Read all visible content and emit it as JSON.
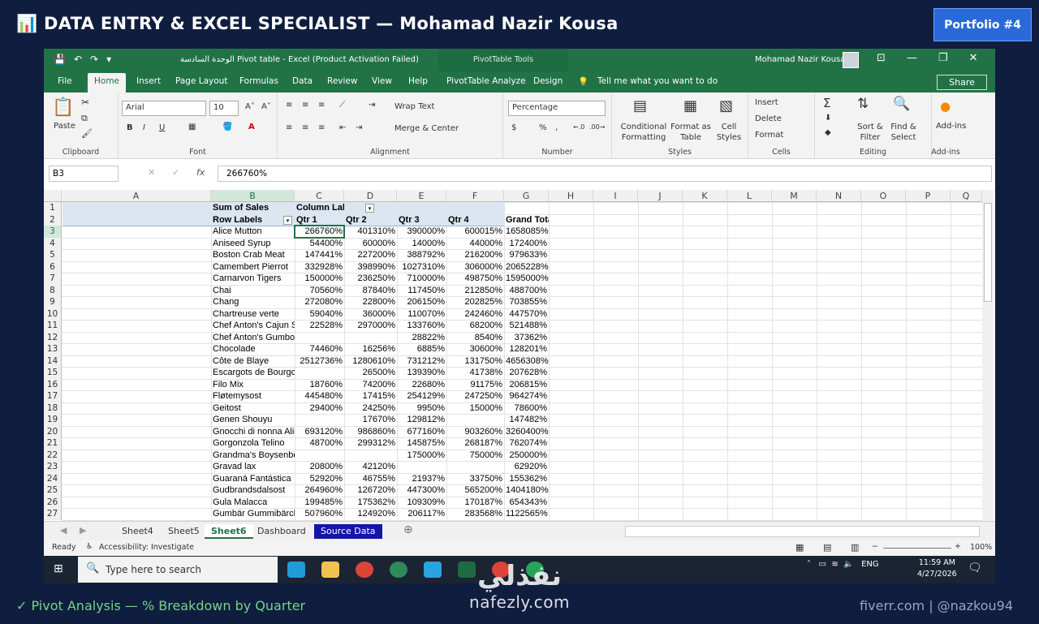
{
  "banner": {
    "title": "📊 DATA ENTRY & EXCEL SPECIALIST — Mohamad Nazir Kousa",
    "badge": "Portfolio #4"
  },
  "footer": {
    "left": "✓ Pivot Analysis — % Breakdown by Quarter",
    "right": "fiverr.com | @nazkou94"
  },
  "watermark": {
    "arabic": "نفذلي",
    "latin": "nafezly.com"
  },
  "titlebar": {
    "doc_title": "الوحدة السادسة Pivot table  -  Excel (Product Activation Failed)",
    "context_tools": "PivotTable Tools",
    "user": "Mohamad Nazir Kousa"
  },
  "tabs": [
    "File",
    "Home",
    "Insert",
    "Page Layout",
    "Formulas",
    "Data",
    "Review",
    "View",
    "Help",
    "PivotTable Analyze",
    "Design"
  ],
  "tell_me": "Tell me what you want to do",
  "share": "Share",
  "ribbon": {
    "clipboard": {
      "label": "Clipboard",
      "paste": "Paste"
    },
    "font": {
      "label": "Font",
      "name": "Arial",
      "size": "10",
      "bold": "B",
      "italic": "I",
      "underline": "U"
    },
    "alignment": {
      "label": "Alignment",
      "wrap": "Wrap Text",
      "merge": "Merge & Center"
    },
    "number": {
      "label": "Number",
      "format": "Percentage",
      "currency": "$",
      "percent": "%",
      "comma": ","
    },
    "styles": {
      "label": "Styles",
      "conditional": "Conditional Formatting",
      "format_table": "Format as Table",
      "cell_styles": "Cell Styles"
    },
    "cells": {
      "label": "Cells",
      "insert": "Insert",
      "delete": "Delete",
      "format": "Format"
    },
    "editing": {
      "label": "Editing",
      "sort": "Sort & Filter",
      "find": "Find & Select"
    },
    "addins": {
      "label": "Add-ins",
      "button": "Add-ins"
    }
  },
  "formula_bar": {
    "name_box": "B3",
    "value": "266760%"
  },
  "columns": [
    "A",
    "B",
    "C",
    "D",
    "E",
    "F",
    "G",
    "H",
    "I",
    "J",
    "K",
    "L",
    "M",
    "N",
    "O",
    "P",
    "Q"
  ],
  "pivot": {
    "r1": {
      "a": "Sum of Sales",
      "b": "Column Labels"
    },
    "r2": {
      "a": "Row Labels",
      "b": "Qtr 1",
      "c": "Qtr 2",
      "d": "Qtr 3",
      "e": "Qtr 4",
      "f": "Grand Total"
    },
    "rows": [
      {
        "n": "3",
        "a": "Alice Mutton",
        "b": "266760%",
        "c": "401310%",
        "d": "390000%",
        "e": "600015%",
        "f": "1658085%"
      },
      {
        "n": "4",
        "a": "Aniseed Syrup",
        "b": "54400%",
        "c": "60000%",
        "d": "14000%",
        "e": "44000%",
        "f": "172400%"
      },
      {
        "n": "5",
        "a": "Boston Crab Meat",
        "b": "147441%",
        "c": "227200%",
        "d": "388792%",
        "e": "216200%",
        "f": "979633%"
      },
      {
        "n": "6",
        "a": "Camembert Pierrot",
        "b": "332928%",
        "c": "398990%",
        "d": "1027310%",
        "e": "306000%",
        "f": "2065228%"
      },
      {
        "n": "7",
        "a": "Carnarvon Tigers",
        "b": "150000%",
        "c": "236250%",
        "d": "710000%",
        "e": "498750%",
        "f": "1595000%"
      },
      {
        "n": "8",
        "a": "Chai",
        "b": "70560%",
        "c": "87840%",
        "d": "117450%",
        "e": "212850%",
        "f": "488700%"
      },
      {
        "n": "9",
        "a": "Chang",
        "b": "272080%",
        "c": "22800%",
        "d": "206150%",
        "e": "202825%",
        "f": "703855%"
      },
      {
        "n": "10",
        "a": "Chartreuse verte",
        "b": "59040%",
        "c": "36000%",
        "d": "110070%",
        "e": "242460%",
        "f": "447570%"
      },
      {
        "n": "11",
        "a": "Chef Anton's Cajun Seasoning",
        "b": "22528%",
        "c": "297000%",
        "d": "133760%",
        "e": "68200%",
        "f": "521488%"
      },
      {
        "n": "12",
        "a": "Chef Anton's Gumbo Mix",
        "b": "",
        "c": "",
        "d": "28822%",
        "e": "8540%",
        "f": "37362%"
      },
      {
        "n": "13",
        "a": "Chocolade",
        "b": "74460%",
        "c": "16256%",
        "d": "6885%",
        "e": "30600%",
        "f": "128201%"
      },
      {
        "n": "14",
        "a": "Côte de Blaye",
        "b": "2512736%",
        "c": "1280610%",
        "d": "731212%",
        "e": "131750%",
        "f": "4656308%"
      },
      {
        "n": "15",
        "a": "Escargots de Bourgogne",
        "b": "",
        "c": "26500%",
        "d": "139390%",
        "e": "41738%",
        "f": "207628%"
      },
      {
        "n": "16",
        "a": "Filo Mix",
        "b": "18760%",
        "c": "74200%",
        "d": "22680%",
        "e": "91175%",
        "f": "206815%"
      },
      {
        "n": "17",
        "a": "Fløtemysost",
        "b": "445480%",
        "c": "17415%",
        "d": "254129%",
        "e": "247250%",
        "f": "964274%"
      },
      {
        "n": "18",
        "a": "Geitost",
        "b": "29400%",
        "c": "24250%",
        "d": "9950%",
        "e": "15000%",
        "f": "78600%"
      },
      {
        "n": "19",
        "a": "Genen Shouyu",
        "b": "",
        "c": "17670%",
        "d": "129812%",
        "e": "",
        "f": "147482%"
      },
      {
        "n": "20",
        "a": "Gnocchi di nonna Alice",
        "b": "693120%",
        "c": "986860%",
        "d": "677160%",
        "e": "903260%",
        "f": "3260400%"
      },
      {
        "n": "21",
        "a": "Gorgonzola Telino",
        "b": "48700%",
        "c": "299312%",
        "d": "145875%",
        "e": "268187%",
        "f": "762074%"
      },
      {
        "n": "22",
        "a": "Grandma's Boysenberry Spread",
        "b": "",
        "c": "",
        "d": "175000%",
        "e": "75000%",
        "f": "250000%"
      },
      {
        "n": "23",
        "a": "Gravad lax",
        "b": "20800%",
        "c": "42120%",
        "d": "",
        "e": "",
        "f": "62920%"
      },
      {
        "n": "24",
        "a": "Guaraná Fantástica",
        "b": "52920%",
        "c": "46755%",
        "d": "21937%",
        "e": "33750%",
        "f": "155362%"
      },
      {
        "n": "25",
        "a": "Gudbrandsdalsost",
        "b": "264960%",
        "c": "126720%",
        "d": "447300%",
        "e": "565200%",
        "f": "1404180%"
      },
      {
        "n": "26",
        "a": "Gula Malacca",
        "b": "199485%",
        "c": "175362%",
        "d": "109309%",
        "e": "170187%",
        "f": "654343%"
      },
      {
        "n": "27",
        "a": "Gumbär Gummibärchen",
        "b": "507960%",
        "c": "124920%",
        "d": "206117%",
        "e": "283568%",
        "f": "1122565%"
      }
    ]
  },
  "sheets": [
    "Sheet4",
    "Sheet5",
    "Sheet6",
    "Dashboard",
    "Source Data"
  ],
  "status": {
    "ready": "Ready",
    "accessibility": "Accessibility: Investigate",
    "zoom": "100%"
  },
  "taskbar": {
    "search_placeholder": "Type here to search",
    "lang": "ENG",
    "time": "11:59 AM",
    "date": "4/27/2026"
  }
}
